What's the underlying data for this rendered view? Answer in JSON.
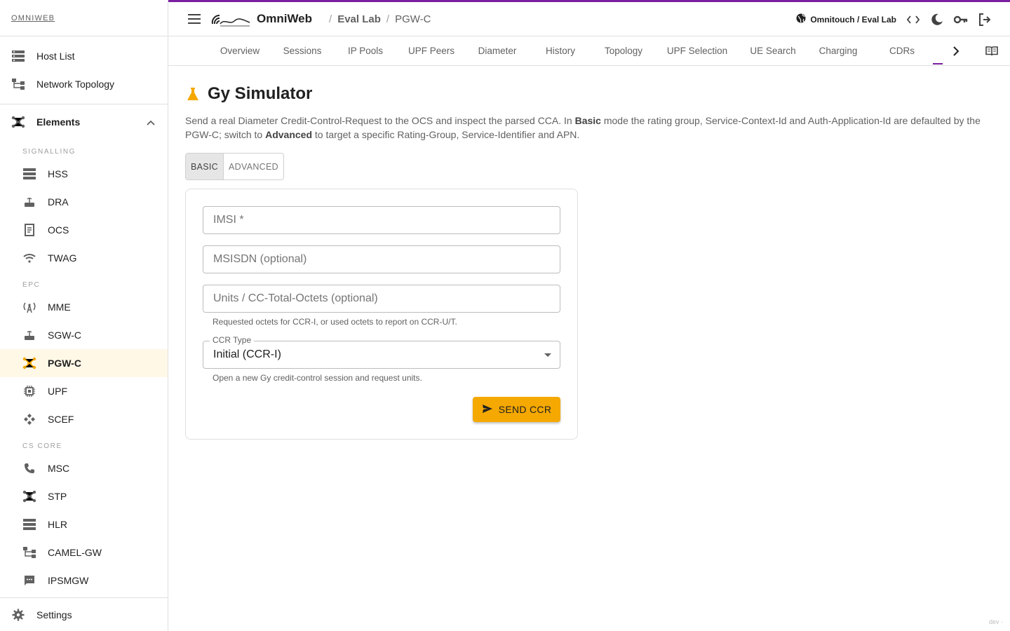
{
  "brand": "OMNIWEB",
  "sidebar": {
    "top_items": [
      {
        "label": "Host List",
        "icon": "host-list-icon"
      },
      {
        "label": "Network Topology",
        "icon": "topology-icon"
      }
    ],
    "group": {
      "label": "Elements",
      "icon": "elements-icon"
    },
    "sections": {
      "signalling": "SIGNALLING",
      "epc": "EPC",
      "cs_core": "CS CORE"
    },
    "signalling_items": [
      {
        "label": "HSS"
      },
      {
        "label": "DRA"
      },
      {
        "label": "OCS"
      },
      {
        "label": "TWAG"
      }
    ],
    "epc_items": [
      {
        "label": "MME"
      },
      {
        "label": "SGW-C"
      },
      {
        "label": "PGW-C"
      },
      {
        "label": "UPF"
      },
      {
        "label": "SCEF"
      }
    ],
    "cs_items": [
      {
        "label": "MSC"
      },
      {
        "label": "STP"
      },
      {
        "label": "HLR"
      },
      {
        "label": "CAMEL-GW"
      },
      {
        "label": "IPSMGW"
      }
    ],
    "settings": "Settings"
  },
  "header": {
    "app_name": "OmniWeb",
    "breadcrumb": [
      "Eval Lab",
      "PGW-C"
    ],
    "tenant": "Omnitouch / Eval Lab",
    "accent": "#7b1fa2"
  },
  "tabs": [
    "Overview",
    "Sessions",
    "IP Pools",
    "UPF Peers",
    "Diameter",
    "History",
    "Topology",
    "UPF Selection",
    "UE Search",
    "Charging",
    "CDRs"
  ],
  "page": {
    "title": "Gy Simulator",
    "desc_1": "Send a real Diameter Credit-Control-Request to the OCS and inspect the parsed CCA. In ",
    "desc_basic": "Basic",
    "desc_2": " mode the rating group, Service-Context-Id and Auth-Application-Id are defaulted by the PGW-C; switch to ",
    "desc_advanced": "Advanced",
    "desc_3": " to target a specific Rating-Group, Service-Identifier and APN.",
    "mode_basic": "BASIC",
    "mode_advanced": "ADVANCED"
  },
  "form": {
    "imsi_placeholder": "IMSI *",
    "msisdn_placeholder": "MSISDN (optional)",
    "units_placeholder": "Units / CC-Total-Octets (optional)",
    "units_helper": "Requested octets for CCR-I, or used octets to report on CCR-U/T.",
    "ccr_type_label": "CCR Type",
    "ccr_type_value": "Initial (CCR-I)",
    "ccr_type_helper": "Open a new Gy credit-control session and request units.",
    "send_label": "SEND CCR"
  },
  "footer": {
    "dev": "dev ·"
  },
  "colors": {
    "primary": "#f5a800",
    "accent": "#7b1fa2",
    "active_bg": "#fff8e7"
  }
}
